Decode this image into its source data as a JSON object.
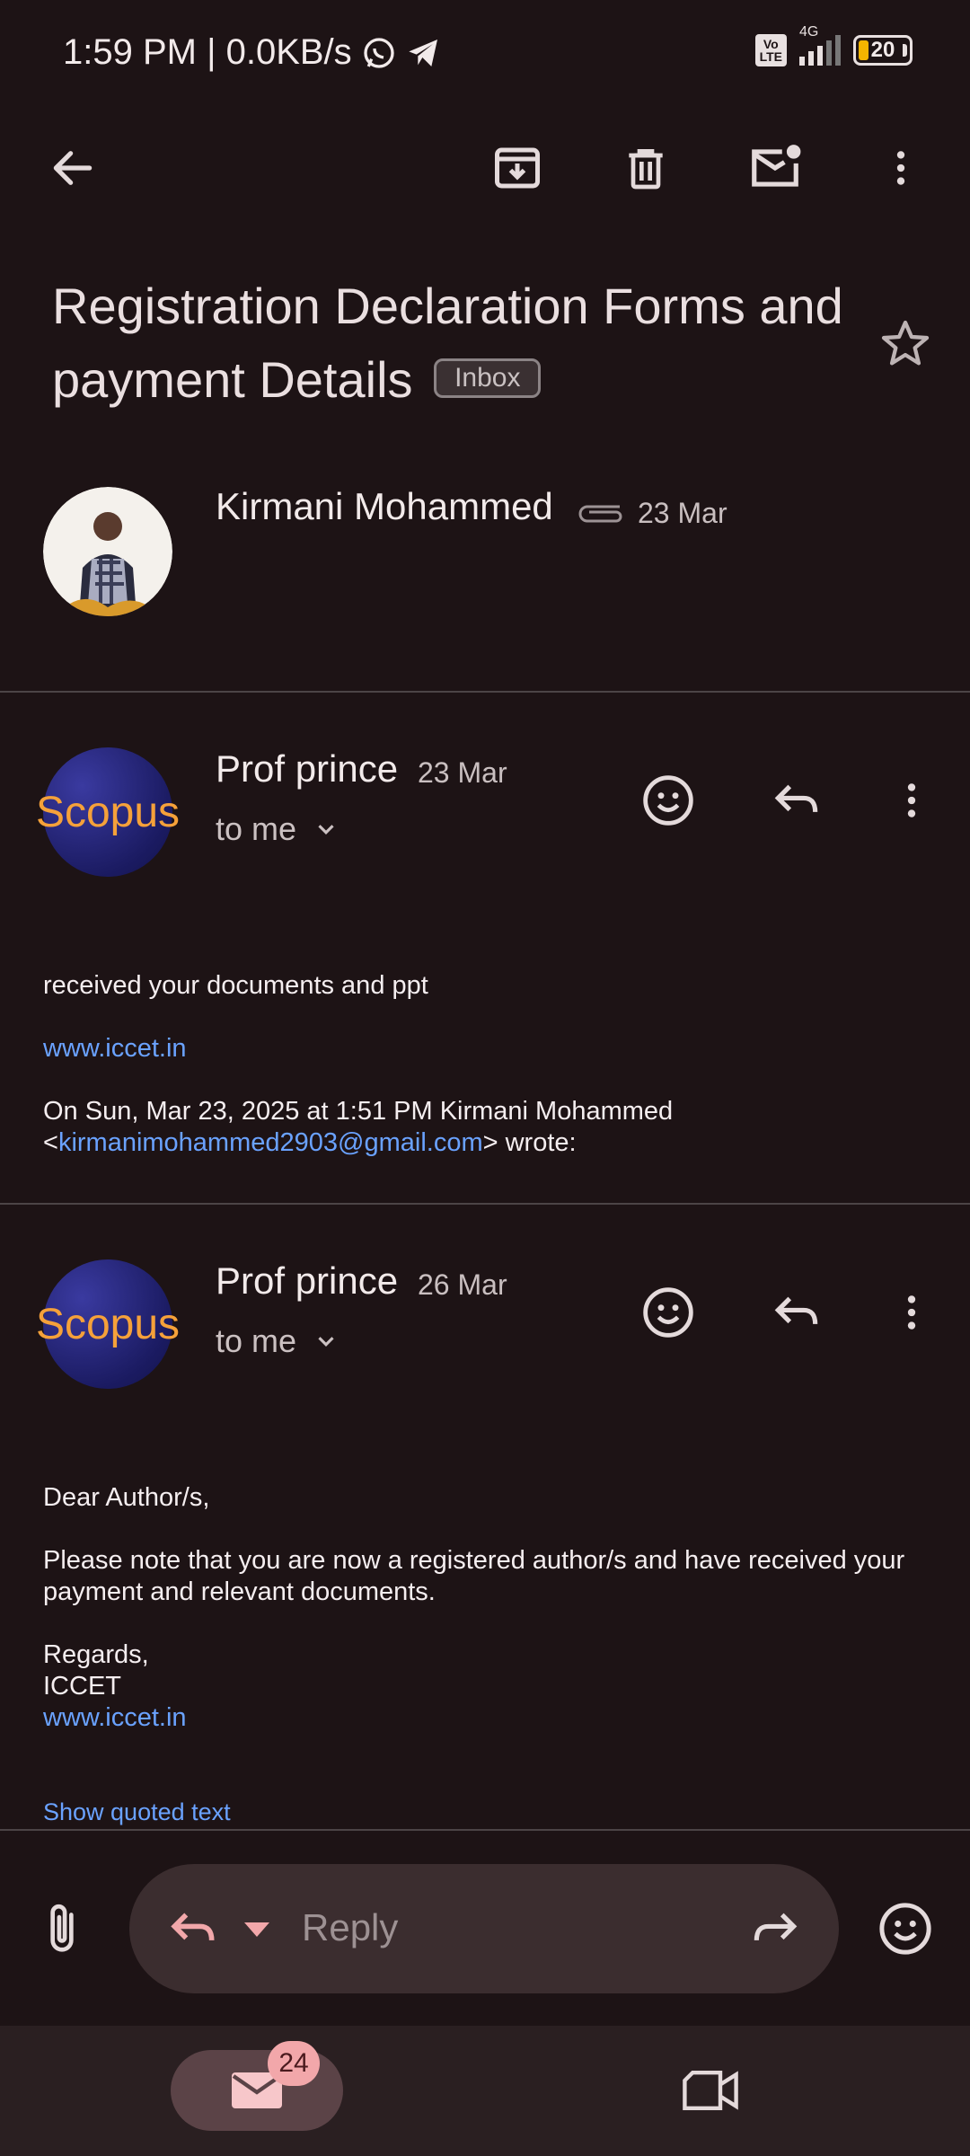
{
  "status_bar": {
    "time_speed": "1:59 PM | 0.0KB/s",
    "network_type": "4G",
    "volte_label": "Vo\nLTE",
    "battery_level": "20",
    "battery_fraction": 0.2
  },
  "toolbar": {
    "back_icon": "arrow-left-icon",
    "archive_icon": "archive-icon",
    "delete_icon": "trash-icon",
    "mark_unread_icon": "mail-unread-icon",
    "more_icon": "more-vert-icon"
  },
  "email": {
    "subject": "Registration Declaration Forms and payment Details",
    "label_chip": "Inbox"
  },
  "messages": [
    {
      "sender": "Kirmani Mohammed",
      "date": "23 Mar",
      "has_attachment": true
    },
    {
      "sender": "Prof prince",
      "date": "23 Mar",
      "recipient": "to me",
      "avatar_text": "Scopus",
      "body_line1": "received your documents and ppt",
      "link": "www.iccet.in",
      "quote_header": "On Sun, Mar 23, 2025 at 1:51 PM Kirmani Mohammed",
      "quote_open": "<",
      "quote_email": "kirmanimohammed2903@gmail.com",
      "quote_close": "> wrote:"
    },
    {
      "sender": "Prof prince",
      "date": "26 Mar",
      "recipient": "to me",
      "avatar_text": "Scopus",
      "greeting": "Dear Author/s,",
      "paragraph": "Please note that you are now a registered author/s and have received your payment and relevant documents.",
      "regards": "Regards,",
      "signature": "ICCET",
      "link": "www.iccet.in",
      "show_quoted": "Show quoted text"
    }
  ],
  "reply_bar": {
    "placeholder": "Reply"
  },
  "bottom_nav": {
    "mail_badge": "24"
  },
  "colors": {
    "background": "#1d1315",
    "link": "#6aa2ff",
    "accent_pink": "#f2a7aa",
    "scopus_orange": "#f5a13a"
  }
}
